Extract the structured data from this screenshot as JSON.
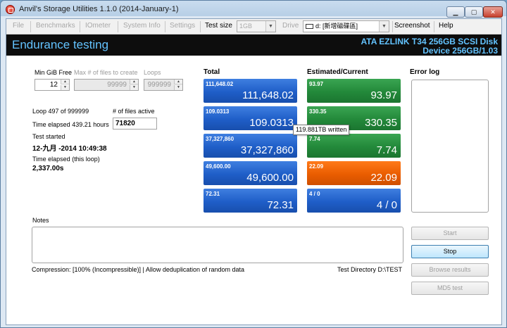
{
  "window": {
    "title": "Anvil's Storage Utilities 1.1.0 (2014-January-1)"
  },
  "window_controls": {
    "minimize": "▁",
    "maximize": "▢",
    "close": "✕"
  },
  "toolbar": {
    "file": "File",
    "benchmarks": "Benchmarks",
    "iometer": "IOmeter",
    "system_info": "System Info",
    "settings": "Settings",
    "test_size_label": "Test size",
    "test_size_value": "1GB",
    "drive_label": "Drive",
    "drive_value": "d: [新增磁碟區]",
    "screenshot": "Screenshot",
    "help": "Help"
  },
  "header": {
    "title": "Endurance testing",
    "disk": "ATA EZLINK T34 256GB SCSI Disk",
    "device": "Device 256GB/1.03"
  },
  "settings": {
    "min_gib_free_label": "Min GiB Free",
    "min_gib_free_value": "12",
    "max_files_label": "Max # of files to create",
    "max_files_value": "99999",
    "loops_label": "Loops",
    "loops_value": "999999"
  },
  "status": {
    "loop": "Loop 497 of 999999",
    "files_active_label": "# of files active",
    "time_elapsed": "Time elapsed 439.21 hours",
    "files_active_value": "71820",
    "test_started_label": "Test started",
    "test_started_value": "12-九月 -2014 10:49:38",
    "time_elapsed_loop_label": "Time elapsed (this loop)",
    "time_elapsed_loop_value": "2,337.00s"
  },
  "columns": {
    "total": "Total",
    "estimated": "Estimated/Current",
    "error_log": "Error log"
  },
  "total_tiles": [
    {
      "small": "111,648.02",
      "big": "111,648.02"
    },
    {
      "small": "109.0313",
      "big": "109.0313"
    },
    {
      "small": "37,327,860",
      "big": "37,327,860"
    },
    {
      "small": "49,600.00",
      "big": "49,600.00"
    },
    {
      "small": "72.31",
      "big": "72.31"
    }
  ],
  "current_tiles": [
    {
      "small": "93.97",
      "big": "93.97",
      "color": "#23893a"
    },
    {
      "small": "330.35",
      "big": "330.35",
      "color": "#23893a"
    },
    {
      "small": "7.74",
      "big": "7.74",
      "color": "#23893a"
    },
    {
      "small": "22.09",
      "big": "22.09",
      "color": "#ea5d00"
    },
    {
      "small": "4 / 0",
      "big": "4 / 0",
      "color": "#1f5ec8"
    }
  ],
  "tooltip": "119.881TB written",
  "notes": {
    "label": "Notes",
    "value": ""
  },
  "footer": {
    "compression": "Compression: [100% (Incompressible)] | Allow deduplication of random data",
    "test_directory": "Test Directory D:\\TEST"
  },
  "buttons": {
    "start": "Start",
    "stop": "Stop",
    "browse": "Browse results",
    "md5": "MD5 test"
  },
  "colors": {
    "header_bg": "#0d0d0d",
    "header_text": "#63c3ff",
    "tile_blue": "#1f5ec8",
    "tile_green": "#23893a",
    "tile_orange": "#ea5d00"
  }
}
